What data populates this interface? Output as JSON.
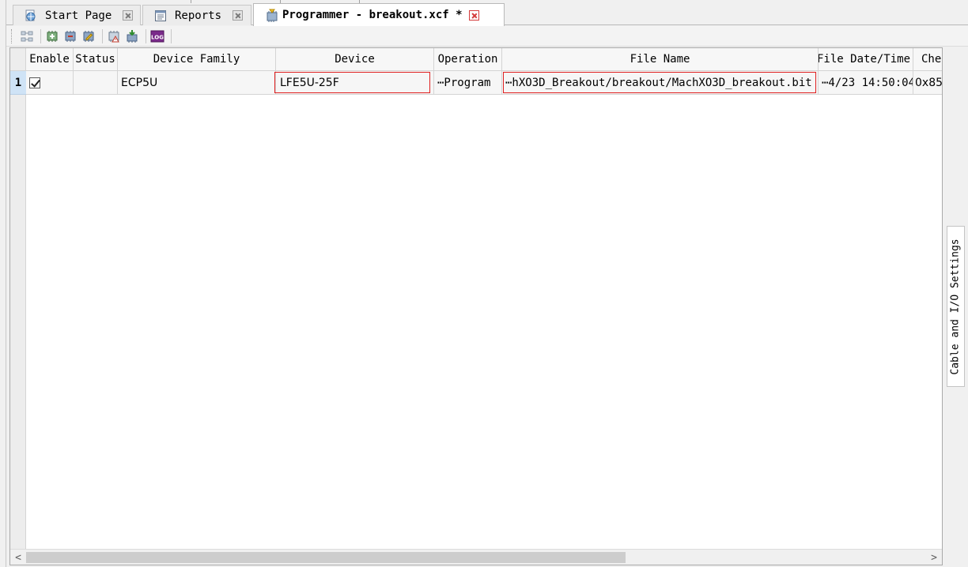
{
  "tabs": [
    {
      "label": "Start Page",
      "icon": "globe-page-icon",
      "active": false
    },
    {
      "label": "Reports",
      "icon": "report-icon",
      "active": false
    },
    {
      "label": "Programmer - breakout.xcf *",
      "icon": "programmer-chip-icon",
      "active": true
    }
  ],
  "toolbar": {
    "buttons": [
      "scan-chain-icon",
      "add-device-icon",
      "remove-device-icon",
      "edit-device-icon",
      "device-properties-icon",
      "program-device-icon",
      "log-icon"
    ],
    "log_label": "LOG"
  },
  "table": {
    "columns": [
      "Enable",
      "Status",
      "Device Family",
      "Device",
      "Operation",
      "File Name",
      "File Date/Time",
      "Che"
    ],
    "rows": [
      {
        "num": "1",
        "enable": true,
        "status": "",
        "family": "ECP5U",
        "device": "LFE5U-25F",
        "operation": "⋯Program",
        "file_name": "⋯hXO3D_Breakout/breakout/MachXO3D_breakout.bit",
        "file_date": "⋯4/23 14:50:04",
        "checksum": "0x85"
      }
    ]
  },
  "scroll": {
    "left": "<",
    "right": ">"
  },
  "side_panel": {
    "label": "Cable and I/O Settings"
  }
}
